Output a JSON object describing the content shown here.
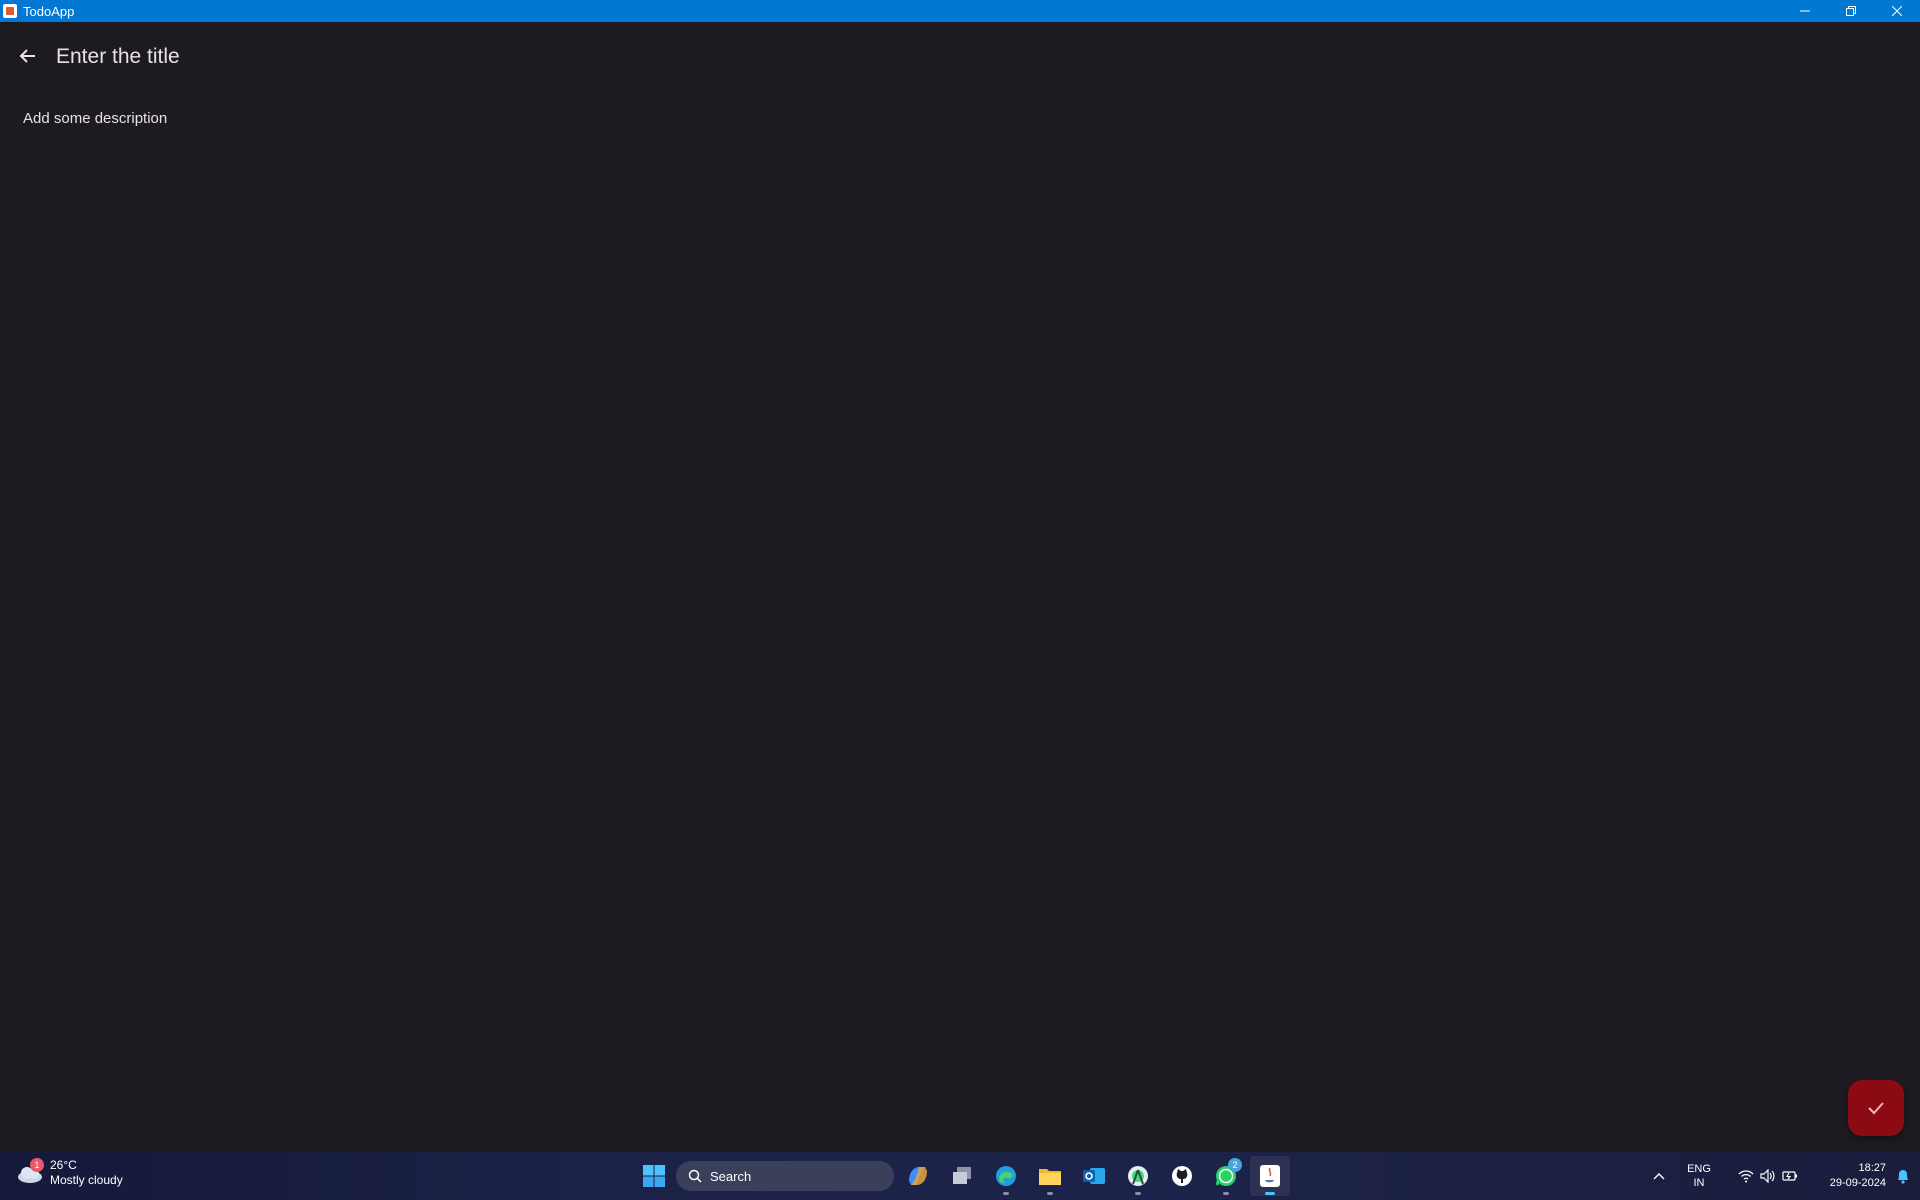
{
  "window": {
    "title": "TodoApp",
    "controls": {
      "minimize": "—",
      "restore": "❐",
      "close": "✕"
    }
  },
  "editor": {
    "title_placeholder": "Enter the title",
    "description_placeholder": "Add some description",
    "back_icon": "arrow-back-icon",
    "save_icon": "check-icon",
    "fab_color": "#8c0a14"
  },
  "taskbar": {
    "weather": {
      "temp": "26°C",
      "condition": "Mostly cloudy",
      "badge": "1"
    },
    "search_label": "Search",
    "apps": [
      {
        "name": "copilot"
      },
      {
        "name": "task-view"
      },
      {
        "name": "edge"
      },
      {
        "name": "file-explorer"
      },
      {
        "name": "outlook"
      },
      {
        "name": "android-studio"
      },
      {
        "name": "github"
      },
      {
        "name": "whatsapp",
        "badge": "2"
      },
      {
        "name": "java"
      }
    ],
    "lang": {
      "line1": "ENG",
      "line2": "IN"
    },
    "time": "18:27",
    "date": "29-09-2024"
  }
}
